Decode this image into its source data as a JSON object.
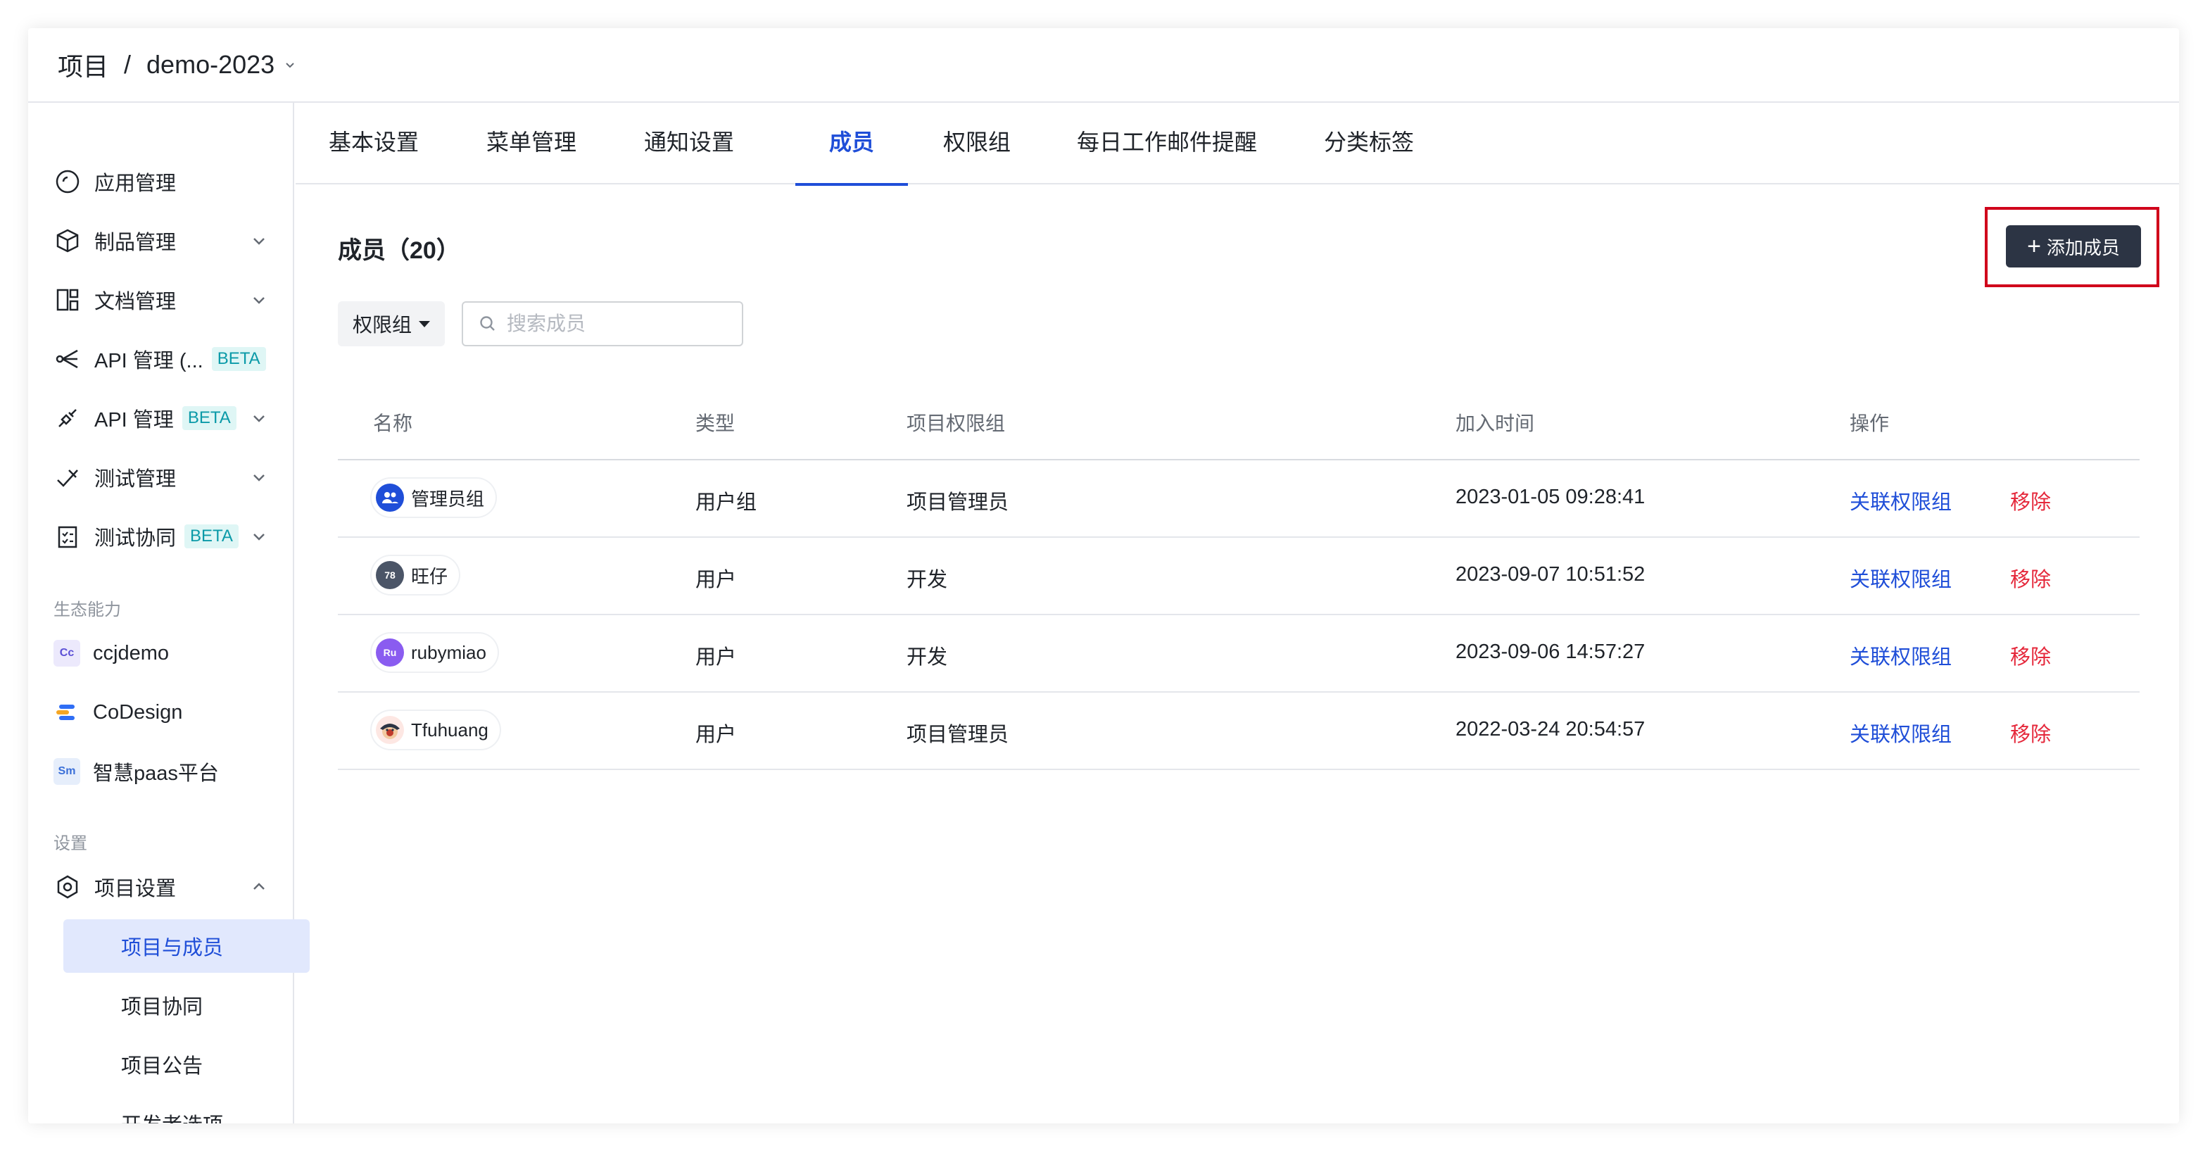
{
  "header": {
    "breadcrumb_root": "项目",
    "separator": "/",
    "project_name": "demo-2023"
  },
  "sidebar": {
    "items": [
      {
        "label": "应用管理",
        "icon": "app-icon"
      },
      {
        "label": "制品管理",
        "icon": "package-icon"
      },
      {
        "label": "文档管理",
        "icon": "document-icon"
      },
      {
        "label": "API 管理 (...",
        "icon": "api-share-icon",
        "badge": "BETA"
      },
      {
        "label": "API 管理",
        "icon": "api-link-icon",
        "badge": "BETA"
      },
      {
        "label": "测试管理",
        "icon": "test-icon"
      },
      {
        "label": "测试协同",
        "icon": "checklist-icon",
        "badge": "BETA"
      }
    ],
    "eco_section_title": "生态能力",
    "eco_apps": [
      {
        "label": "ccjdemo",
        "badge_text": "Cc",
        "color": "#5b4fd6",
        "bg": "#ece9fc"
      },
      {
        "label": "CoDesign",
        "badge_text": "",
        "color": "#2f6ef5",
        "bg": "#ffffff"
      },
      {
        "label": "智慧paas平台",
        "badge_text": "Sm",
        "color": "#3a6fd8",
        "bg": "#e6eefb"
      }
    ],
    "settings_section_title": "设置",
    "project_settings_label": "项目设置",
    "sub_items": [
      {
        "label": "项目与成员",
        "active": true
      },
      {
        "label": "项目协同",
        "active": false
      },
      {
        "label": "项目公告",
        "active": false
      },
      {
        "label": "开发者选项",
        "active": false
      }
    ]
  },
  "tabs": [
    {
      "label": "基本设置"
    },
    {
      "label": "菜单管理"
    },
    {
      "label": "通知设置"
    },
    {
      "label": "成员"
    },
    {
      "label": "权限组"
    },
    {
      "label": "每日工作邮件提醒"
    },
    {
      "label": "分类标签"
    }
  ],
  "main": {
    "title": "成员（20）",
    "add_button_label": "添加成员",
    "filter_label": "权限组",
    "search_placeholder": "搜索成员"
  },
  "table": {
    "columns": [
      "名称",
      "类型",
      "项目权限组",
      "加入时间",
      "操作"
    ],
    "action_link": "关联权限组",
    "action_remove": "移除",
    "rows": [
      {
        "name": "管理员组",
        "avatar_text": "",
        "avatar_color": "#1f4ed8",
        "type": "用户组",
        "group": "项目管理员",
        "joined": "2023-01-05 09:28:41"
      },
      {
        "name": "旺仔",
        "avatar_text": "78",
        "avatar_color": "#4b5567",
        "type": "用户",
        "group": "开发",
        "joined": "2023-09-07 10:51:52"
      },
      {
        "name": "rubymiao",
        "avatar_text": "Ru",
        "avatar_color": "#8a5cf0",
        "type": "用户",
        "group": "开发",
        "joined": "2023-09-06 14:57:27"
      },
      {
        "name": "Tfuhuang",
        "avatar_text": "",
        "avatar_color": "#c0392b",
        "type": "用户",
        "group": "项目管理员",
        "joined": "2022-03-24 20:54:57"
      }
    ]
  }
}
